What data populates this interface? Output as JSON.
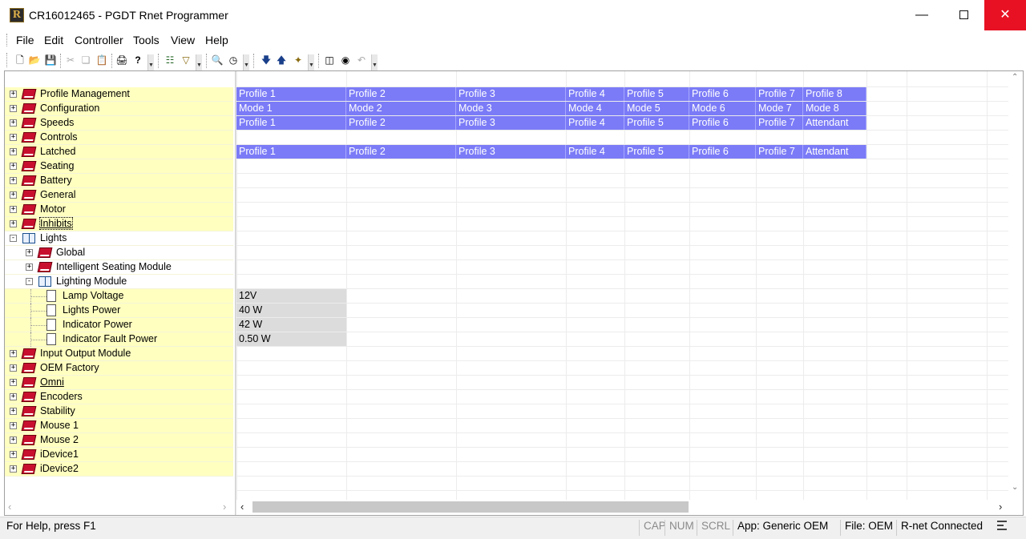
{
  "window": {
    "title": "CR16012465 - PGDT Rnet Programmer",
    "icon_letter": "R",
    "controls": [
      "minimize-icon",
      "maximize-icon",
      "close-icon"
    ]
  },
  "menu": [
    "File",
    "Edit",
    "Controller",
    "Tools",
    "View",
    "Help"
  ],
  "toolbar": {
    "icons": [
      "new-file-icon",
      "open-folder-icon",
      "save-icon",
      "cut-icon",
      "copy-icon",
      "paste-icon",
      "print-icon",
      "help-icon",
      "tree-icon",
      "filter-icon",
      "search-icon",
      "clock-icon",
      "download-icon",
      "upload-icon",
      "wand-icon",
      "compare-icon",
      "binoculars-icon",
      "undo-icon"
    ]
  },
  "tree": [
    {
      "label": "Profile Management",
      "level": 0,
      "icon": "book-closed",
      "expander": "+"
    },
    {
      "label": "Configuration",
      "level": 0,
      "icon": "book-closed",
      "expander": "+"
    },
    {
      "label": "Speeds",
      "level": 0,
      "icon": "book-closed",
      "expander": "+"
    },
    {
      "label": "Controls",
      "level": 0,
      "icon": "book-closed",
      "expander": "+"
    },
    {
      "label": "Latched",
      "level": 0,
      "icon": "book-closed",
      "expander": "+"
    },
    {
      "label": "Seating",
      "level": 0,
      "icon": "book-closed",
      "expander": "+"
    },
    {
      "label": "Battery",
      "level": 0,
      "icon": "book-closed",
      "expander": "+"
    },
    {
      "label": "General",
      "level": 0,
      "icon": "book-closed",
      "expander": "+"
    },
    {
      "label": "Motor",
      "level": 0,
      "icon": "book-closed",
      "expander": "+"
    },
    {
      "label": "Inhibits",
      "level": 0,
      "icon": "book-closed",
      "expander": "+",
      "underline": true,
      "focused": true
    },
    {
      "label": "Lights",
      "level": 0,
      "icon": "book-open",
      "expander": "-"
    },
    {
      "label": "Global",
      "level": 1,
      "icon": "book-closed",
      "expander": "+"
    },
    {
      "label": "Intelligent Seating Module",
      "level": 1,
      "icon": "book-closed",
      "expander": "+"
    },
    {
      "label": "Lighting Module",
      "level": 1,
      "icon": "book-open",
      "expander": "-"
    },
    {
      "label": "Lamp Voltage",
      "level": 2,
      "icon": "page",
      "expander": ""
    },
    {
      "label": "Lights Power",
      "level": 2,
      "icon": "page",
      "expander": ""
    },
    {
      "label": "Indicator Power",
      "level": 2,
      "icon": "page",
      "expander": ""
    },
    {
      "label": "Indicator Fault Power",
      "level": 2,
      "icon": "page",
      "expander": ""
    },
    {
      "label": "Input Output Module",
      "level": 0,
      "icon": "book-closed",
      "expander": "+"
    },
    {
      "label": "OEM Factory",
      "level": 0,
      "icon": "book-closed",
      "expander": "+"
    },
    {
      "label": "Omni",
      "level": 0,
      "icon": "book-closed",
      "expander": "+",
      "underline": true
    },
    {
      "label": "Encoders",
      "level": 0,
      "icon": "book-closed",
      "expander": "+"
    },
    {
      "label": "Stability",
      "level": 0,
      "icon": "book-closed",
      "expander": "+"
    },
    {
      "label": "Mouse 1",
      "level": 0,
      "icon": "book-closed",
      "expander": "+"
    },
    {
      "label": "Mouse 2",
      "level": 0,
      "icon": "book-closed",
      "expander": "+"
    },
    {
      "label": "iDevice1",
      "level": 0,
      "icon": "book-closed",
      "expander": "+"
    },
    {
      "label": "iDevice2",
      "level": 0,
      "icon": "book-closed",
      "expander": "+"
    }
  ],
  "grid": {
    "rows": [
      {
        "row": 0,
        "style": "sel",
        "cells": [
          "Profile 1",
          "Profile 2",
          "Profile 3",
          "Profile 4",
          "Profile 5",
          "Profile 6",
          "Profile 7",
          "Profile 8"
        ]
      },
      {
        "row": 1,
        "style": "sel",
        "cells": [
          "Mode 1",
          "Mode 2",
          "Mode 3",
          "Mode 4",
          "Mode 5",
          "Mode 6",
          "Mode 7",
          "Mode 8"
        ]
      },
      {
        "row": 2,
        "style": "sel",
        "cells": [
          "Profile 1",
          "Profile 2",
          "Profile 3",
          "Profile 4",
          "Profile 5",
          "Profile 6",
          "Profile 7",
          "Attendant"
        ]
      },
      {
        "row": 4,
        "style": "sel",
        "cells": [
          "Profile 1",
          "Profile 2",
          "Profile 3",
          "Profile 4",
          "Profile 5",
          "Profile 6",
          "Profile 7",
          "Attendant"
        ]
      },
      {
        "row": 14,
        "style": "val",
        "cells": [
          "12V"
        ]
      },
      {
        "row": 15,
        "style": "val",
        "cells": [
          "40 W"
        ]
      },
      {
        "row": 16,
        "style": "val",
        "cells": [
          "42 W"
        ]
      },
      {
        "row": 17,
        "style": "val",
        "cells": [
          "0.50 W"
        ]
      }
    ]
  },
  "status": {
    "help": "For Help, press F1",
    "cap": "CAP",
    "num": "NUM",
    "scrl": "SCRL",
    "app": "App: Generic OEM",
    "file": "File: OEM",
    "connection": "R-net Connected"
  },
  "colors": {
    "selection": "#7b7bf7",
    "tree_background": "#ffffc0",
    "value_cell": "#dcdcdc",
    "close_button": "#e81123"
  }
}
